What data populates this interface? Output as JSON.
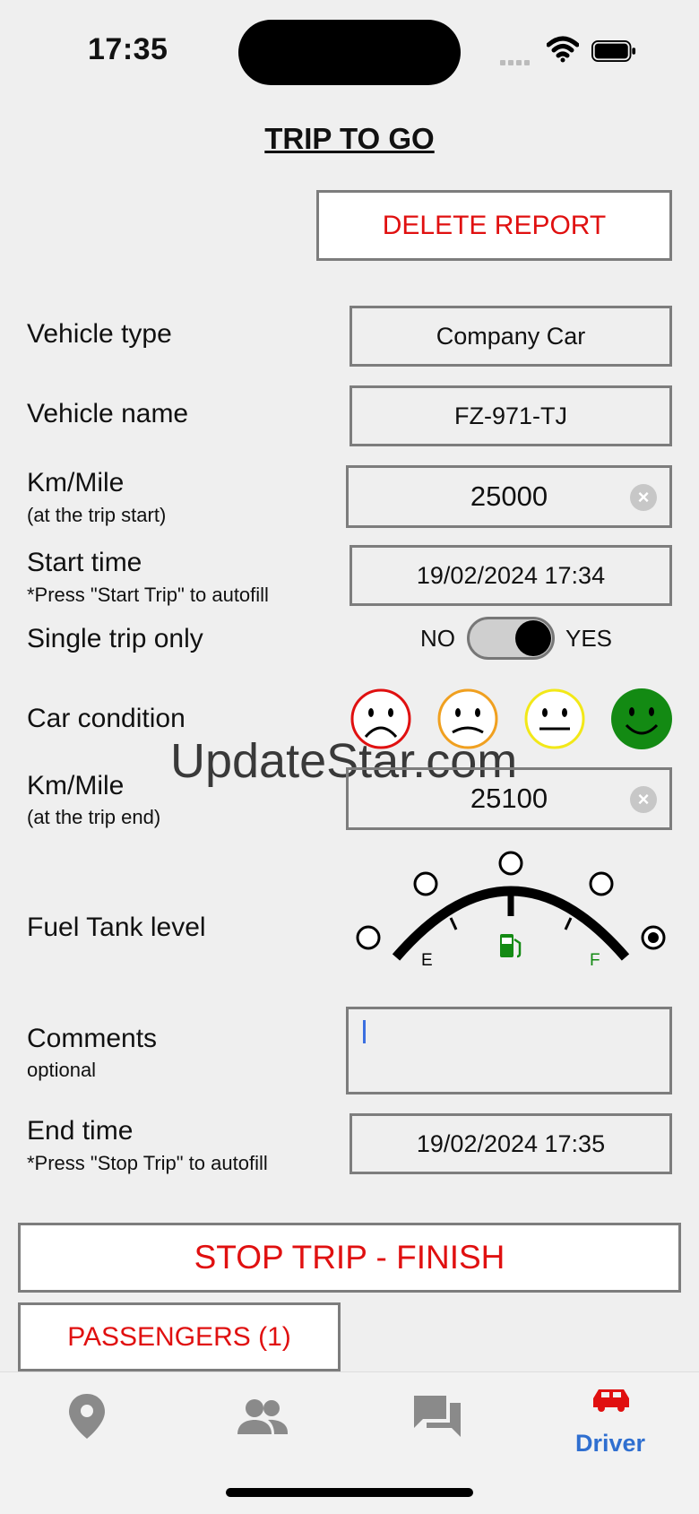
{
  "status_bar": {
    "time": "17:35"
  },
  "page": {
    "title": "TRIP TO GO"
  },
  "actions": {
    "delete_label": "DELETE REPORT",
    "stop_trip_label": "STOP TRIP - FINISH",
    "passengers_label": "PASSENGERS (1)"
  },
  "form": {
    "vehicle_type": {
      "label": "Vehicle type",
      "value": "Company Car"
    },
    "vehicle_name": {
      "label": "Vehicle name",
      "value": "FZ-971-TJ"
    },
    "km_start": {
      "label": "Km/Mile",
      "sublabel": "(at the trip start)",
      "value": "25000"
    },
    "start_time": {
      "label": "Start time",
      "sublabel": "*Press \"Start Trip\" to autofill",
      "value": "19/02/2024 17:34"
    },
    "single_trip": {
      "label": "Single trip only",
      "no_label": "NO",
      "yes_label": "YES",
      "value": true
    },
    "car_condition": {
      "label": "Car condition",
      "options": [
        "very-bad",
        "bad",
        "neutral",
        "good"
      ],
      "selected": "good"
    },
    "km_end": {
      "label": "Km/Mile",
      "sublabel": "(at the trip end)",
      "value": "25100"
    },
    "fuel_level": {
      "label": "Fuel Tank level",
      "empty_label": "E",
      "full_label": "F",
      "levels": 5,
      "selected_level": 5
    },
    "comments": {
      "label": "Comments",
      "sublabel": "optional",
      "value": ""
    },
    "end_time": {
      "label": "End time",
      "sublabel": "*Press \"Stop Trip\" to autofill",
      "value": "19/02/2024 17:35"
    }
  },
  "watermark": "UpdateStar.com",
  "tab_bar": {
    "tabs": [
      {
        "icon": "location-pin-icon",
        "label": ""
      },
      {
        "icon": "people-icon",
        "label": ""
      },
      {
        "icon": "chat-icon",
        "label": ""
      },
      {
        "icon": "car-icon",
        "label": "Driver",
        "active": true
      }
    ],
    "active_color": "#2f6fd0"
  },
  "colors": {
    "accent_red": "#e01010",
    "good_green": "#138a13"
  }
}
